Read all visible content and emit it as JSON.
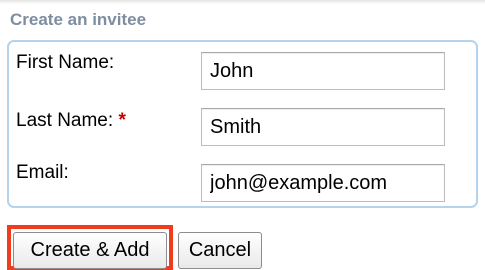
{
  "form": {
    "title": "Create an invitee",
    "fields": [
      {
        "label": "First Name:",
        "required": false,
        "value": "John"
      },
      {
        "label": "Last Name:",
        "required": true,
        "required_marker": "*",
        "value": "Smith"
      },
      {
        "label": "Email:",
        "required": false,
        "value": "john@example.com"
      }
    ]
  },
  "actions": {
    "create_add_label": "Create & Add",
    "cancel_label": "Cancel",
    "create_add_highlighted": true
  },
  "colors": {
    "title": "#7e8ea1",
    "panel_border": "#b5d3ec",
    "required": "#cc0000",
    "highlight": "#f03b1f"
  }
}
